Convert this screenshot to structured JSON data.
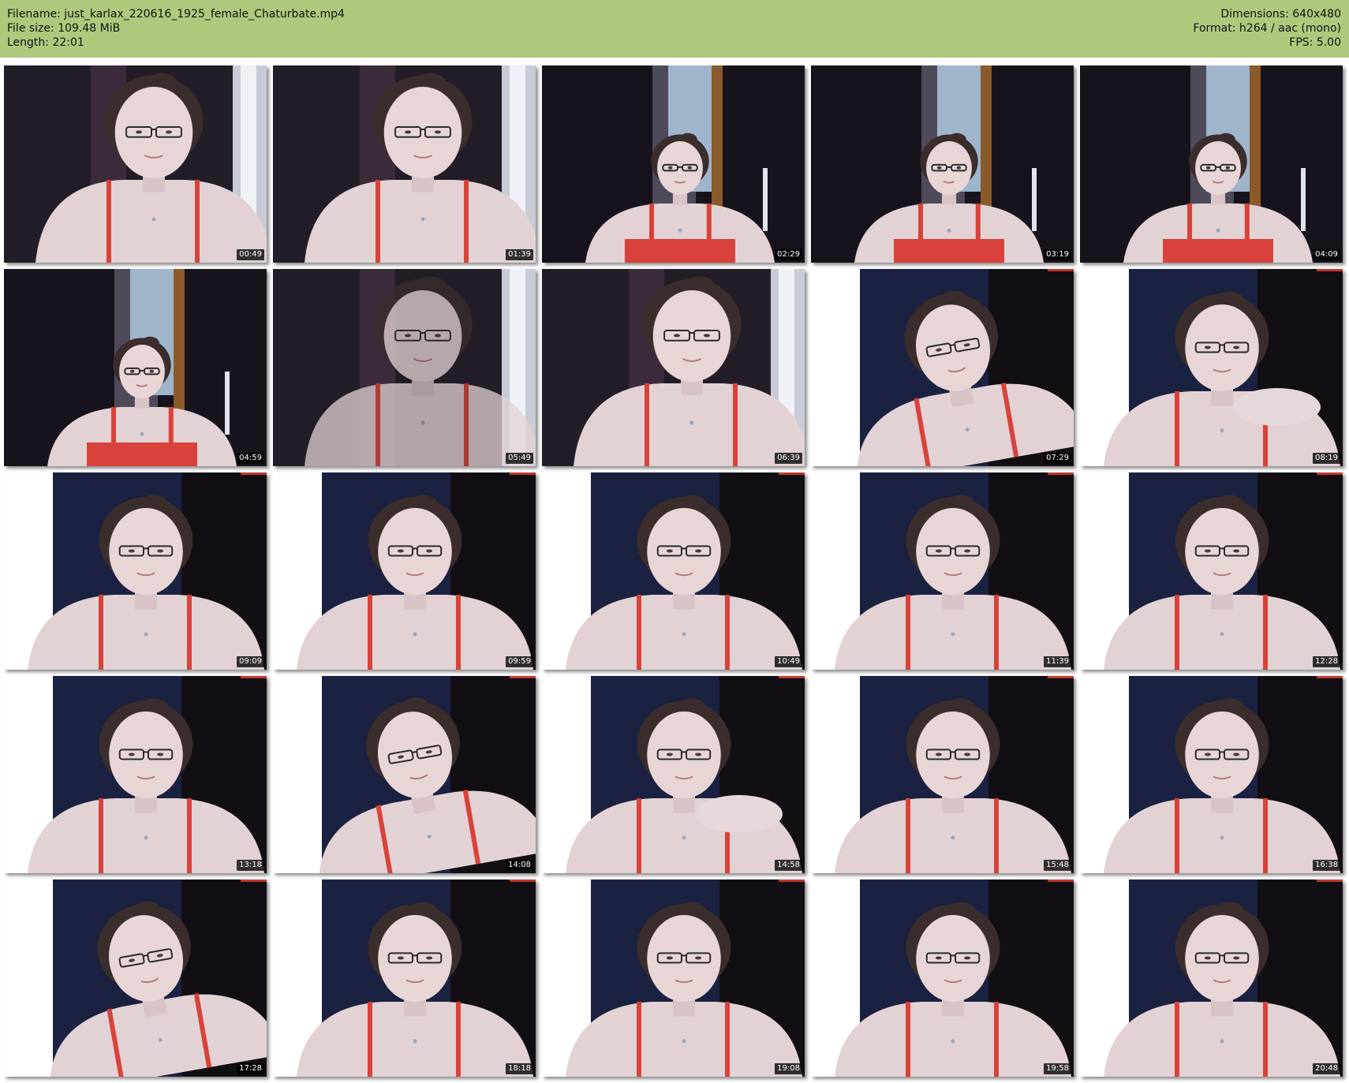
{
  "header": {
    "filename_line": "Filename: just_karlax_220616_1925_female_Chaturbate.mp4",
    "filesize_line": "File size: 109.48 MiB",
    "length_line": "Length: 22:01",
    "dimensions_line": "Dimensions: 640x480",
    "format_line": "Format: h264 / aac (mono)",
    "fps_line": "FPS: 5.00"
  },
  "colors": {
    "header_bg": "#aec97c",
    "strap": "#d8423a",
    "skin": "#e2d2d4",
    "hair": "#3a2d2c"
  },
  "thumbnails": [
    {
      "timestamp": "00:49",
      "scene": "close-dark"
    },
    {
      "timestamp": "01:39",
      "scene": "close-dark"
    },
    {
      "timestamp": "02:29",
      "scene": "far-window"
    },
    {
      "timestamp": "03:19",
      "scene": "far-window"
    },
    {
      "timestamp": "04:09",
      "scene": "far-window"
    },
    {
      "timestamp": "04:59",
      "scene": "far-window"
    },
    {
      "timestamp": "05:49",
      "scene": "blurred"
    },
    {
      "timestamp": "06:39",
      "scene": "close-dark"
    },
    {
      "timestamp": "07:29",
      "scene": "bright-tilt"
    },
    {
      "timestamp": "08:19",
      "scene": "bright-hand"
    },
    {
      "timestamp": "09:09",
      "scene": "bright"
    },
    {
      "timestamp": "09:59",
      "scene": "bright"
    },
    {
      "timestamp": "10:49",
      "scene": "bright"
    },
    {
      "timestamp": "11:39",
      "scene": "bright"
    },
    {
      "timestamp": "12:28",
      "scene": "bright"
    },
    {
      "timestamp": "13:18",
      "scene": "bright"
    },
    {
      "timestamp": "14:08",
      "scene": "bright-tilt"
    },
    {
      "timestamp": "14:58",
      "scene": "bright-hand"
    },
    {
      "timestamp": "15:48",
      "scene": "bright"
    },
    {
      "timestamp": "16:38",
      "scene": "bright"
    },
    {
      "timestamp": "17:28",
      "scene": "bright-tilt"
    },
    {
      "timestamp": "18:18",
      "scene": "bright"
    },
    {
      "timestamp": "19:08",
      "scene": "bright"
    },
    {
      "timestamp": "19:58",
      "scene": "bright"
    },
    {
      "timestamp": "20:48",
      "scene": "bright"
    }
  ]
}
